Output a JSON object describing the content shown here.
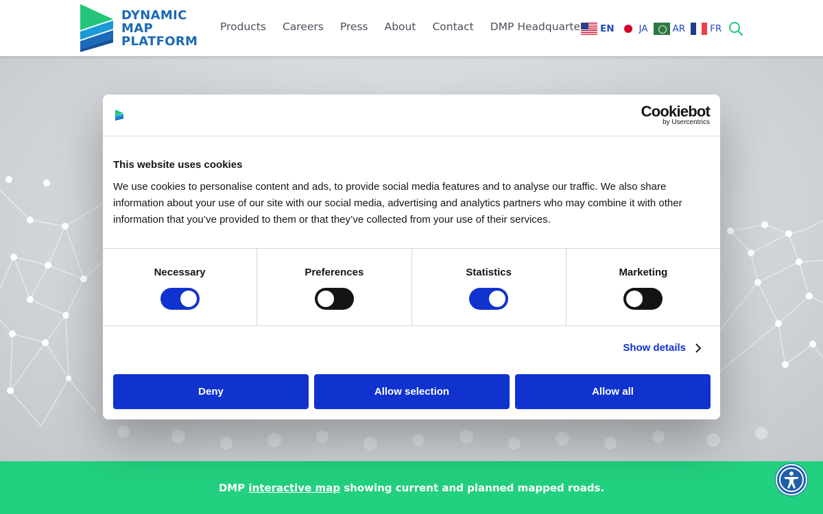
{
  "header": {
    "logo_lines": [
      "DYNAMIC",
      "MAP",
      "PLATFORM"
    ],
    "nav": [
      "Products",
      "Careers",
      "Press",
      "About",
      "Contact",
      "DMP Headquarters"
    ],
    "languages": [
      {
        "code": "EN",
        "flag": "us-flag-icon",
        "active": true
      },
      {
        "code": "JA",
        "flag": "japan-flag-icon",
        "active": false
      },
      {
        "code": "AR",
        "flag": "saudi-flag-icon",
        "active": false
      },
      {
        "code": "FR",
        "flag": "france-flag-icon",
        "active": false
      }
    ],
    "search_icon": "search-icon",
    "colors": {
      "logo_blue": "#1a6ab7",
      "logo_green": "#22c57a",
      "lang_link": "#2449c3"
    }
  },
  "cookie_dialog": {
    "brand": {
      "name": "Cookiebot",
      "by": "by Usercentrics"
    },
    "title": "This website uses cookies",
    "text": "We use cookies to personalise content and ads, to provide social media features and to analyse our traffic. We also share information about your use of our site with our social media, advertising and analytics partners who may combine it with other information that you’ve provided to them or that they’ve collected from your use of their services.",
    "categories": [
      {
        "label": "Necessary",
        "enabled": true
      },
      {
        "label": "Preferences",
        "enabled": false
      },
      {
        "label": "Statistics",
        "enabled": true
      },
      {
        "label": "Marketing",
        "enabled": false
      }
    ],
    "show_details": "Show details",
    "buttons": {
      "deny": "Deny",
      "allow_selection": "Allow selection",
      "allow_all": "Allow all"
    },
    "colors": {
      "primary": "#1032cf",
      "toggle_off": "#141414"
    }
  },
  "banner": {
    "prefix": "DMP",
    "link": "interactive map",
    "suffix": "showing current and planned mapped roads.",
    "color": "#22d07f"
  },
  "accessibility": {
    "icon": "accessibility-icon"
  }
}
